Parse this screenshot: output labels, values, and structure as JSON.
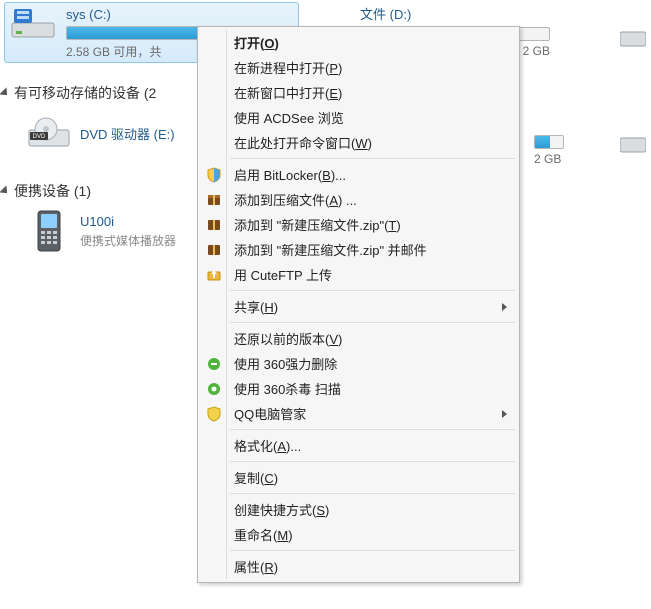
{
  "drive_c": {
    "name": "sys (C:)",
    "stat": "2.58 GB 可用，共",
    "fill_pct": 92
  },
  "drive_d": {
    "name": "文件 (D:)",
    "stat_tail": "2 GB",
    "fill_pct": 62
  },
  "drive_f": {
    "stat_tail": "2 GB"
  },
  "section_removable": "有可移动存储的设备 (2",
  "dvd": {
    "name": "DVD 驱动器 (E:)"
  },
  "section_portable": "便携设备 (1)",
  "phone": {
    "name": "U100i",
    "sub": "便携式媒体播放器"
  },
  "menu": {
    "open": "打开(O)",
    "open_new_proc": "在新进程中打开(P)",
    "open_new_win": "在新窗口中打开(E)",
    "acdsee": "使用 ACDSee 浏览",
    "cmd_here": "在此处打开命令窗口(W)",
    "bitlocker": "启用 BitLocker(B)...",
    "add_archive": "添加到压缩文件(A) ...",
    "add_zip": "添加到 \"新建压缩文件.zip\"(T)",
    "add_zip_mail": "添加到 \"新建压缩文件.zip\" 并邮件",
    "cuteftp": "用 CuteFTP 上传",
    "share": "共享(H)",
    "restore": "还原以前的版本(V)",
    "del360": "使用 360强力删除",
    "scan360": "使用 360杀毒 扫描",
    "qqguard": "QQ电脑管家",
    "format": "格式化(A)...",
    "copy": "复制(C)",
    "shortcut": "创建快捷方式(S)",
    "rename": "重命名(M)",
    "properties": "属性(R)"
  }
}
